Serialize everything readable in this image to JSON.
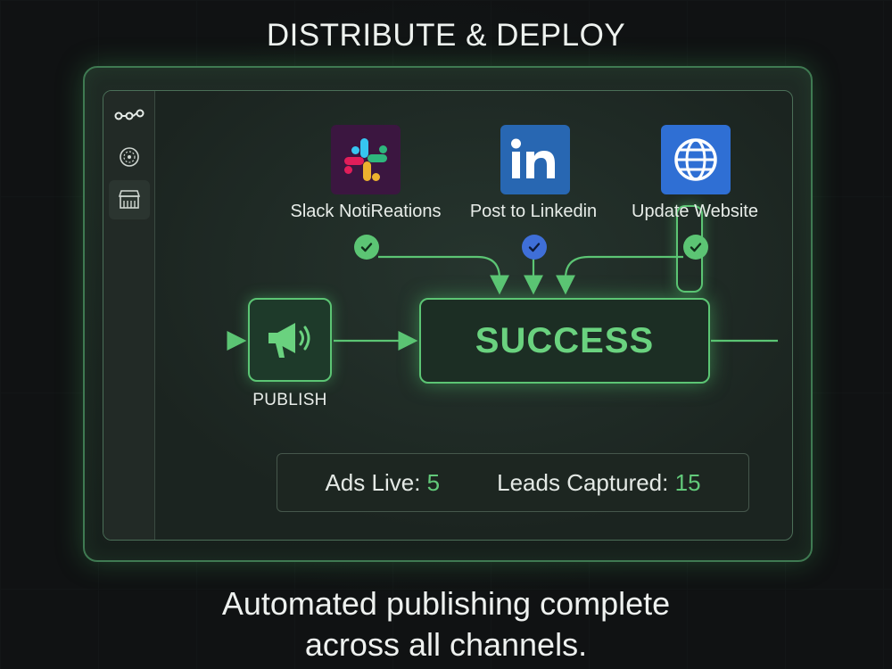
{
  "page": {
    "title": "DISTRIBUTE & DEPLOY",
    "caption_line1": "Automated publishing complete",
    "caption_line2": "across all channels."
  },
  "sidebar": {
    "items": [
      {
        "icon": "workflow-icon",
        "active": false
      },
      {
        "icon": "settings-dial-icon",
        "active": false
      },
      {
        "icon": "storefront-icon",
        "active": true
      }
    ]
  },
  "integrations": [
    {
      "label": "Slack NotiReations",
      "icon": "slack-icon",
      "status": "success",
      "status_color": "#5cc574"
    },
    {
      "label": "Post to Linkedin",
      "icon": "linkedin-icon",
      "status": "success",
      "status_color": "#3f6fd8"
    },
    {
      "label": "Update Website",
      "icon": "globe-icon",
      "status": "success",
      "status_color": "#5cc574"
    }
  ],
  "flow": {
    "publish_label": "PUBLISH",
    "success_label": "SUCCESS"
  },
  "stats": {
    "ads_live_label": "Ads Live:",
    "ads_live_value": "5",
    "leads_label": "Leads Captured:",
    "leads_value": "15"
  },
  "colors": {
    "accent_green": "#5cc574",
    "background": "#101213",
    "linkedin_blue": "#2867b2",
    "globe_blue": "#2f6fd4",
    "slack_bg": "#4a154b"
  }
}
